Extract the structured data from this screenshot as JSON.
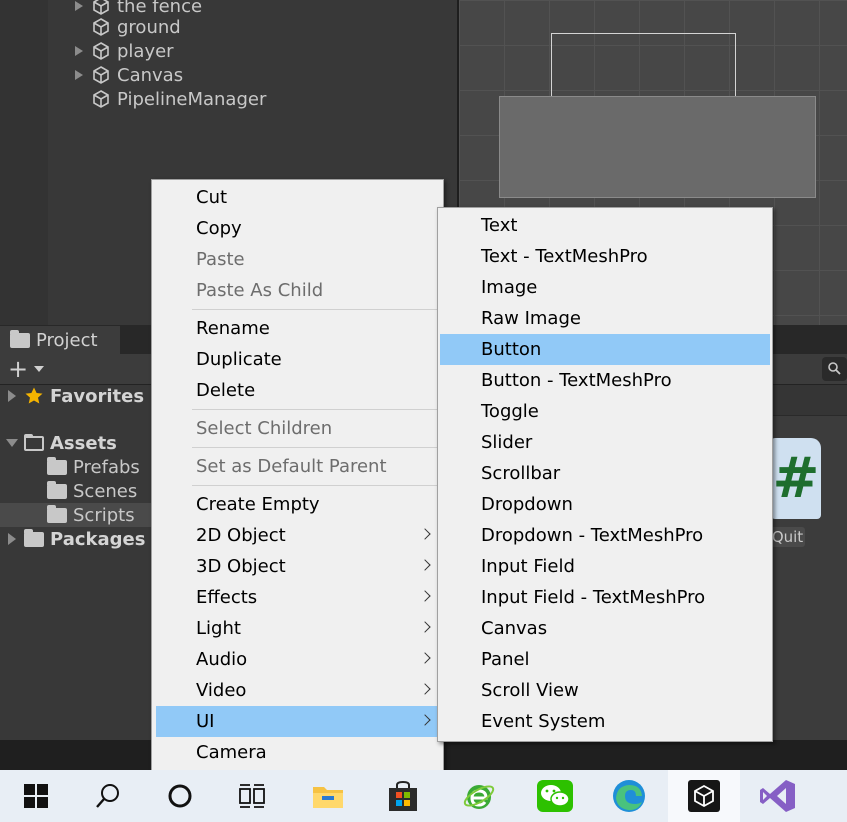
{
  "hierarchy": {
    "items": [
      {
        "label": "the fence",
        "expandable": true
      },
      {
        "label": "ground",
        "expandable": false
      },
      {
        "label": "player",
        "expandable": true
      },
      {
        "label": "Canvas",
        "expandable": true
      },
      {
        "label": "PipelineManager",
        "expandable": false
      }
    ]
  },
  "project": {
    "tab_label": "Project",
    "add_label": "+",
    "tree": {
      "favorites": "Favorites",
      "assets": "Assets",
      "prefabs": "Prefabs",
      "scenes": "Scenes",
      "scripts": "Scripts",
      "packages": "Packages"
    },
    "asset": {
      "icon_glyph": "#",
      "label": "Quit"
    }
  },
  "context_menu": {
    "items": [
      {
        "label": "Cut",
        "enabled": true
      },
      {
        "label": "Copy",
        "enabled": true
      },
      {
        "label": "Paste",
        "enabled": false
      },
      {
        "label": "Paste As Child",
        "enabled": false
      },
      {
        "label": "Rename",
        "enabled": true
      },
      {
        "label": "Duplicate",
        "enabled": true
      },
      {
        "label": "Delete",
        "enabled": true
      },
      {
        "label": "Select Children",
        "enabled": false
      },
      {
        "label": "Set as Default Parent",
        "enabled": false
      },
      {
        "label": "Create Empty",
        "enabled": true
      },
      {
        "label": "2D Object",
        "enabled": true,
        "submenu": true
      },
      {
        "label": "3D Object",
        "enabled": true,
        "submenu": true
      },
      {
        "label": "Effects",
        "enabled": true,
        "submenu": true
      },
      {
        "label": "Light",
        "enabled": true,
        "submenu": true
      },
      {
        "label": "Audio",
        "enabled": true,
        "submenu": true
      },
      {
        "label": "Video",
        "enabled": true,
        "submenu": true
      },
      {
        "label": "UI",
        "enabled": true,
        "submenu": true,
        "highlighted": true
      },
      {
        "label": "Camera",
        "enabled": true
      }
    ]
  },
  "ui_submenu": {
    "items": [
      {
        "label": "Text"
      },
      {
        "label": "Text - TextMeshPro"
      },
      {
        "label": "Image"
      },
      {
        "label": "Raw Image"
      },
      {
        "label": "Button",
        "highlighted": true
      },
      {
        "label": "Button - TextMeshPro"
      },
      {
        "label": "Toggle"
      },
      {
        "label": "Slider"
      },
      {
        "label": "Scrollbar"
      },
      {
        "label": "Dropdown"
      },
      {
        "label": "Dropdown - TextMeshPro"
      },
      {
        "label": "Input Field"
      },
      {
        "label": "Input Field - TextMeshPro"
      },
      {
        "label": "Canvas"
      },
      {
        "label": "Panel"
      },
      {
        "label": "Scroll View"
      },
      {
        "label": "Event System"
      }
    ]
  },
  "taskbar": {
    "icons": [
      "windows-start-icon",
      "search-icon",
      "cortana-icon",
      "task-view-icon",
      "file-explorer-icon",
      "store-icon",
      "ie-browser-icon",
      "wechat-icon",
      "edge-icon",
      "unity-icon",
      "visual-studio-icon"
    ],
    "active": "unity-icon"
  },
  "colors": {
    "menu_highlight": "#91c9f7",
    "menu_bg": "#f0f0f0",
    "editor_bg": "#383838"
  }
}
